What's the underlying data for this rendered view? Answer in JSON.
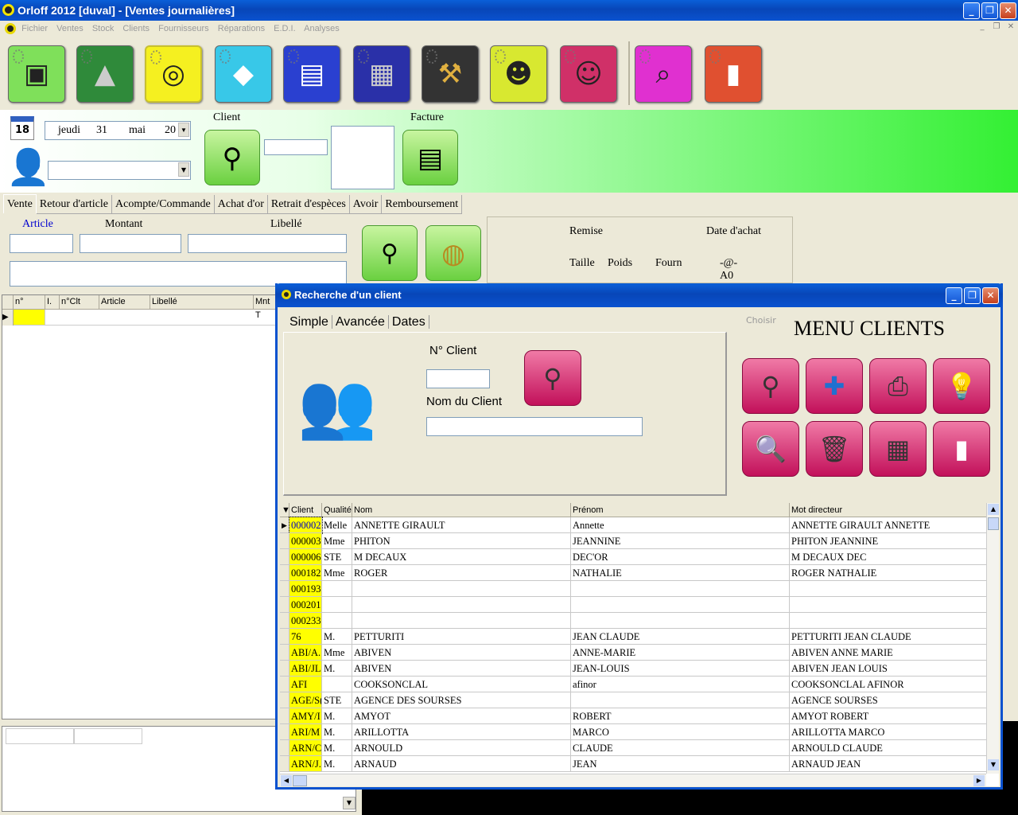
{
  "window": {
    "title": "Orloff 2012 [duval] - [Ventes journalières]"
  },
  "menu": [
    "Fichier",
    "Ventes",
    "Stock",
    "Clients",
    "Fournisseurs",
    "Réparations",
    "E.D.I.",
    "Analyses"
  ],
  "toolbar": {
    "icons": [
      "cash-register-icon",
      "tent-icon",
      "gold-jewelry-icon",
      "diamond-icon",
      "invoice-clipboard-icon",
      "safe-icon",
      "toolbox-icon",
      "customers-icon",
      "group-icon",
      "analysis-icon",
      "exit-door-icon"
    ],
    "colors": [
      "#7fe05a",
      "#2f8a3a",
      "#f5f020",
      "#38c8e8",
      "#2a40d0",
      "#2a30a8",
      "#333333",
      "#d8e830",
      "#d03068",
      "#e030d0",
      "#e05030"
    ]
  },
  "header": {
    "date": {
      "day_name": "jeudi",
      "day": "31",
      "month": "mai",
      "year": "20"
    },
    "client_label": "Client",
    "facture_label": "Facture",
    "calendar_number": "18"
  },
  "tabs": [
    "Vente",
    "Retour d'article",
    "Acompte/Commande",
    "Achat d'or",
    "Retrait d'espèces",
    "Avoir",
    "Remboursement"
  ],
  "sale_form": {
    "article": "Article",
    "montant": "Montant",
    "libelle": "Libellé"
  },
  "info_panel": {
    "remise": "Remise",
    "date_achat": "Date d'achat",
    "taille": "Taille",
    "poids": "Poids",
    "fourn": "Fourn",
    "at": "-@-",
    "code": "A0"
  },
  "left_grid": {
    "headers": [
      "n°",
      "I.",
      "n°Clt",
      "Article",
      "Libellé",
      "Mnt T"
    ]
  },
  "dialog": {
    "title": "Recherche d'un client",
    "tabs": [
      "Simple",
      "Avancée",
      "Dates"
    ],
    "choisir": "Choisir",
    "menu_title": "MENU CLIENTS",
    "n_client_label": "N° Client",
    "nom_client_label": "Nom du Client",
    "menu_icons": [
      "binoculars-icon",
      "add-cross-icon",
      "printer-icon",
      "lightbulb-icon",
      "magnifier-icon",
      "trash-icon",
      "calculator-icon",
      "exit-door-icon"
    ],
    "table": {
      "headers": [
        "Client",
        "Qualité",
        "Nom",
        "Prénom",
        "Mot directeur"
      ],
      "rows": [
        [
          "000002",
          "Melle",
          "ANNETTE GIRAULT",
          "Annette",
          "ANNETTE GIRAULT ANNETTE"
        ],
        [
          "000003",
          "Mme",
          " PHITON",
          "JEANNINE",
          "PHITON JEANNINE"
        ],
        [
          "000006",
          "STE",
          "M DECAUX",
          "DEC'OR",
          "M DECAUX DEC"
        ],
        [
          "000182",
          "Mme",
          "ROGER",
          "NATHALIE",
          "ROGER NATHALIE"
        ],
        [
          "000193",
          "",
          "",
          "",
          ""
        ],
        [
          "000201",
          "",
          "",
          "",
          ""
        ],
        [
          "000233",
          "",
          "",
          "",
          ""
        ],
        [
          "76",
          "M.",
          "PETTURITI",
          "JEAN CLAUDE",
          "PETTURITI JEAN CLAUDE"
        ],
        [
          "ABI/A.",
          "Mme",
          "ABIVEN",
          "ANNE-MARIE",
          "ABIVEN ANNE MARIE"
        ],
        [
          "ABI/JL",
          "M.",
          "ABIVEN",
          "JEAN-LOUIS",
          "ABIVEN JEAN LOUIS"
        ],
        [
          "AFI",
          "",
          "COOKSONCLAL",
          "afinor",
          "COOKSONCLAL AFINOR"
        ],
        [
          "AGE/S(",
          "STE",
          "AGENCE DES SOURSES",
          "",
          "AGENCE SOURSES"
        ],
        [
          "AMY/I",
          "M.",
          "AMYOT",
          "ROBERT",
          "AMYOT ROBERT"
        ],
        [
          "ARI/M",
          "M.",
          "ARILLOTTA",
          "MARCO",
          "ARILLOTTA MARCO"
        ],
        [
          "ARN/C",
          "M.",
          "ARNOULD",
          "CLAUDE",
          "ARNOULD CLAUDE"
        ],
        [
          "ARN/J.",
          "M.",
          "ARNAUD",
          "JEAN",
          "ARNAUD JEAN"
        ]
      ]
    }
  }
}
